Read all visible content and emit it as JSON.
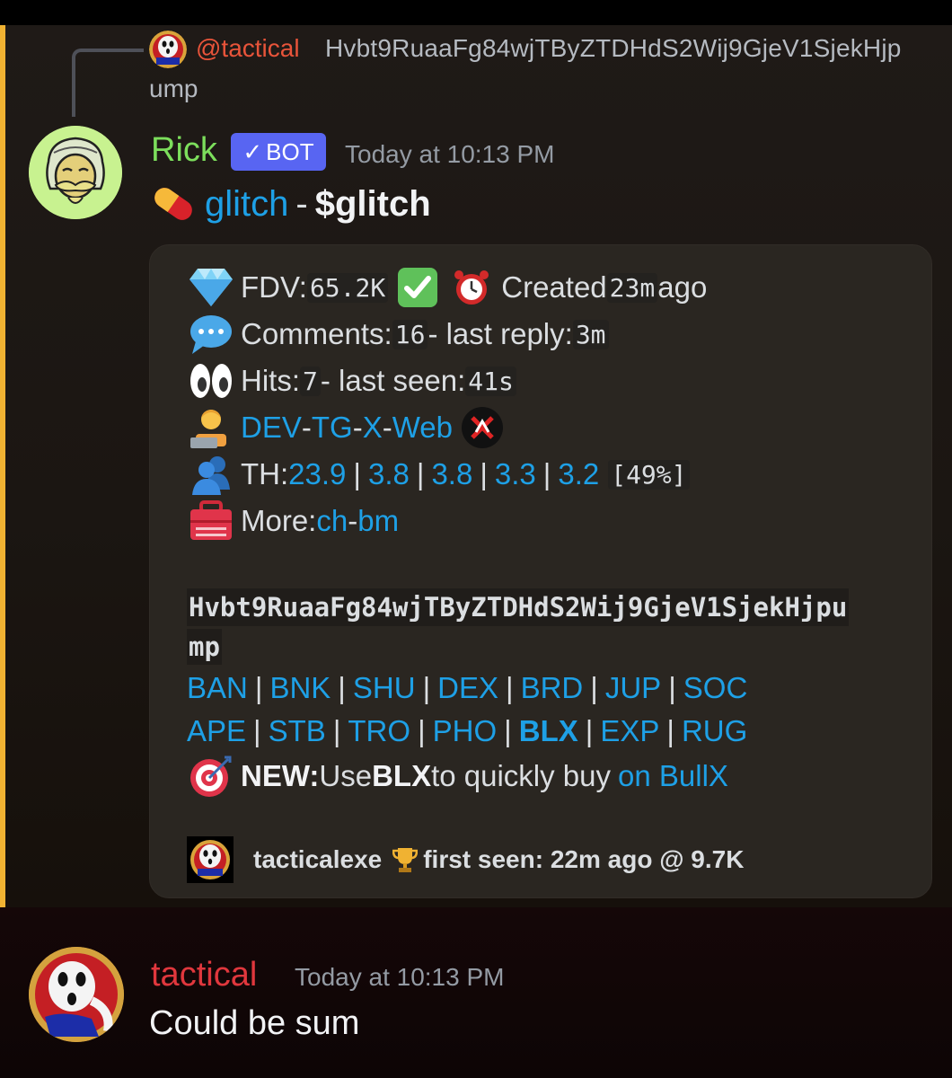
{
  "reply": {
    "mention": "@tactical",
    "text_line1": "Hvbt9RuaaFg84wjTByZTDHdS2Wij9GjeV1SjekHjp",
    "text_line2": "ump"
  },
  "bot_message": {
    "username": "Rick",
    "badge_label": "BOT",
    "timestamp": "Today at 10:13 PM",
    "title_link": "glitch",
    "title_separator": " - ",
    "title_ticker": "$glitch",
    "embed": {
      "fdv_label": "FDV: ",
      "fdv_value": "65.2K",
      "created_label": " Created ",
      "created_value": "23m",
      "created_suffix": " ago",
      "comments_label": "Comments: ",
      "comments_value": "16",
      "last_reply_label": " - last reply: ",
      "last_reply_value": "3m",
      "hits_label": "Hits: ",
      "hits_value": "7",
      "last_seen_label": " - last seen: ",
      "last_seen_value": "41s",
      "links": [
        "DEV",
        "TG",
        "X",
        "Web"
      ],
      "link_sep": " - ",
      "th_label": "TH: ",
      "th_values": [
        "23.9",
        "3.8",
        "3.8",
        "3.3",
        "3.2"
      ],
      "th_percent": "[49%]",
      "more_label": "More: ",
      "more_links": [
        "ch",
        "bm"
      ],
      "address_line1": "Hvbt9RuaaFg84wjTByZTDHdS2Wij9GjeV1SjekHjpu",
      "address_line2": "mp",
      "platforms_row1": [
        "BAN",
        "BNK",
        "SHU",
        "DEX",
        "BRD",
        "JUP",
        "SOC"
      ],
      "platforms_row2": [
        "APE",
        "STB",
        "TRO",
        "PHO",
        "BLX",
        "EXP",
        "RUG"
      ],
      "new_label": "NEW:",
      "new_text1": " Use ",
      "new_bold": "BLX",
      "new_text2": " to quickly buy ",
      "new_link": "on BullX",
      "footer_user": "tacticalexe",
      "footer_text": " first seen: 22m ago @ 9.7K"
    }
  },
  "user_message": {
    "username": "tactical",
    "timestamp": "Today at 10:13 PM",
    "text": "Could be sum"
  },
  "colors": {
    "link": "#1ea0e6",
    "rick_name": "#7cde5c",
    "tactical_name": "#e0373d",
    "bot_badge": "#5865f2",
    "highlight_bar": "#f0b232"
  },
  "icons": [
    "gem-icon",
    "check-mark-icon",
    "alarm-clock-icon",
    "speech-bubble-icon",
    "eyes-icon",
    "technologist-icon",
    "no-entry-x-icon",
    "busts-icon",
    "toolbox-icon",
    "target-icon",
    "trophy-icon",
    "pill-icon"
  ]
}
